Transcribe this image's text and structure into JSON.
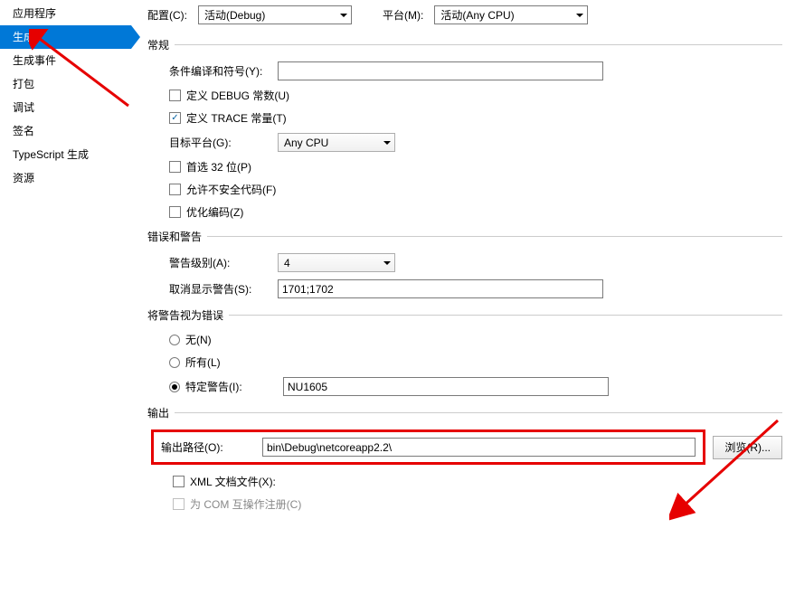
{
  "sidebar": {
    "items": [
      {
        "label": "应用程序"
      },
      {
        "label": "生成",
        "active": true
      },
      {
        "label": "生成事件"
      },
      {
        "label": "打包"
      },
      {
        "label": "调试"
      },
      {
        "label": "签名"
      },
      {
        "label": "TypeScript 生成"
      },
      {
        "label": "资源"
      }
    ]
  },
  "top": {
    "config_label": "配置(C):",
    "config_value": "活动(Debug)",
    "platform_label": "平台(M):",
    "platform_value": "活动(Any CPU)"
  },
  "sections": {
    "general": "常规",
    "errors": "错误和警告",
    "treat_as_error": "将警告视为错误",
    "output": "输出"
  },
  "general": {
    "cond_label": "条件编译和符号(Y):",
    "cond_value": "",
    "define_debug": "定义 DEBUG 常数(U)",
    "define_trace": "定义 TRACE 常量(T)",
    "target_label": "目标平台(G):",
    "target_value": "Any CPU",
    "prefer32": "首选 32 位(P)",
    "unsafe": "允许不安全代码(F)",
    "optimize": "优化编码(Z)"
  },
  "errors": {
    "level_label": "警告级别(A):",
    "level_value": "4",
    "suppress_label": "取消显示警告(S):",
    "suppress_value": "1701;1702"
  },
  "treat": {
    "none": "无(N)",
    "all": "所有(L)",
    "specific_label": "特定警告(I):",
    "specific_value": "NU1605"
  },
  "output": {
    "path_label": "输出路径(O):",
    "path_value": "bin\\Debug\\netcoreapp2.2\\",
    "browse": "浏览(R)...",
    "xml_label": "XML 文档文件(X):",
    "com_label": "为 COM 互操作注册(C)"
  }
}
